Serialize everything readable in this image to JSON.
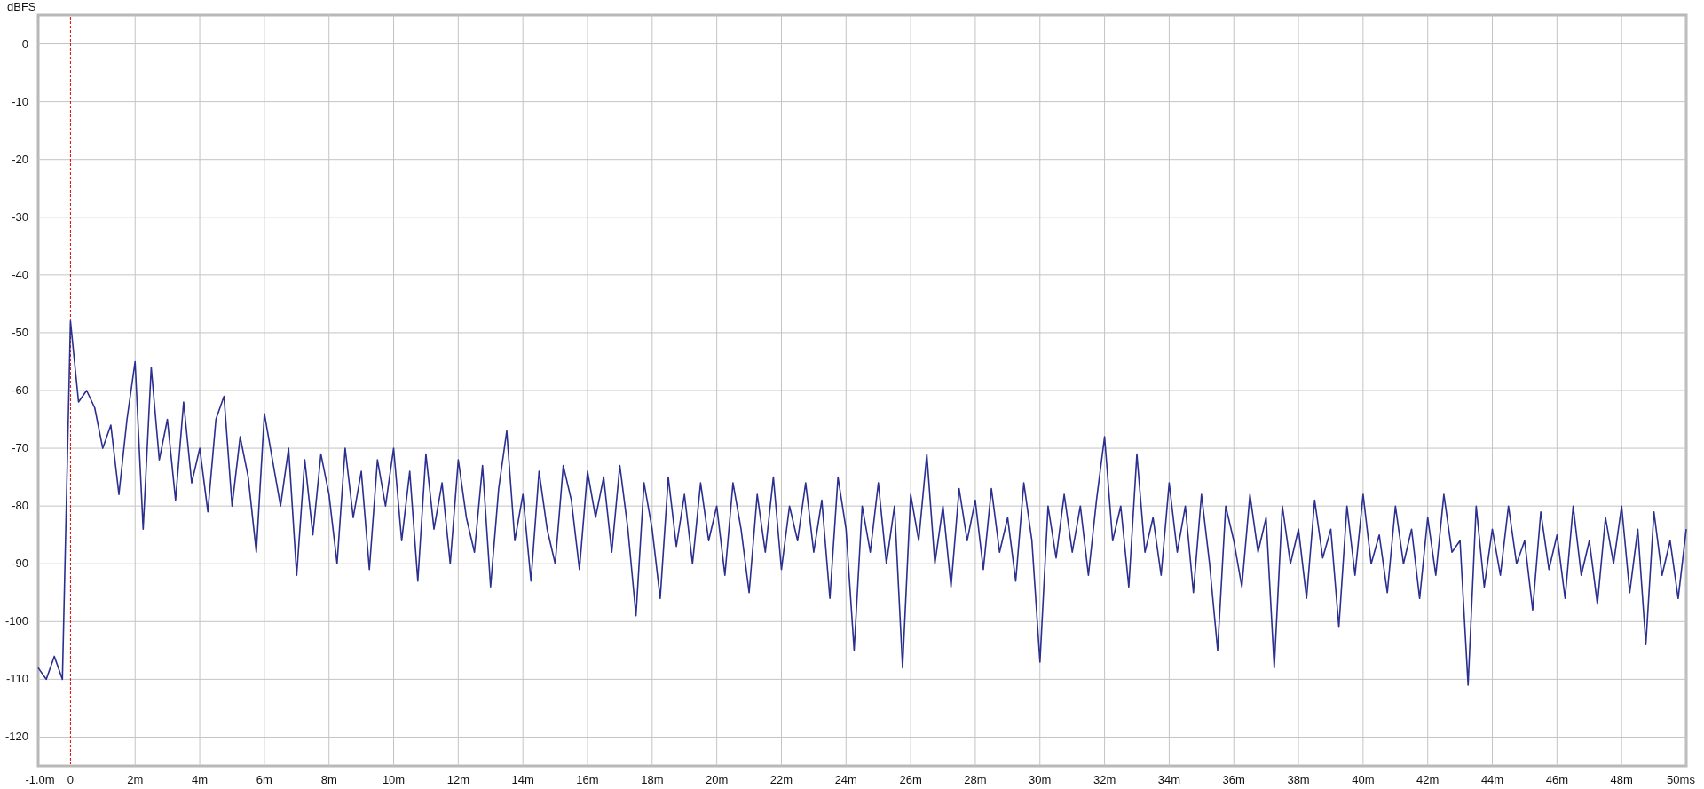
{
  "chart_data": {
    "type": "line",
    "ylabel": "dBFS",
    "xlim": [
      -1,
      50
    ],
    "ylim": [
      -125,
      5
    ],
    "grid": true,
    "ref_lines": [
      {
        "axis": "x",
        "value": 0,
        "color": "#e00000"
      }
    ],
    "yticks": [
      0,
      -10,
      -20,
      -30,
      -40,
      -50,
      -60,
      -70,
      -80,
      -90,
      -100,
      -110,
      -120
    ],
    "xticks": [
      {
        "value": -1,
        "label": "-1.0m"
      },
      {
        "value": 0,
        "label": "0"
      },
      {
        "value": 2,
        "label": "2m"
      },
      {
        "value": 4,
        "label": "4m"
      },
      {
        "value": 6,
        "label": "6m"
      },
      {
        "value": 8,
        "label": "8m"
      },
      {
        "value": 10,
        "label": "10m"
      },
      {
        "value": 12,
        "label": "12m"
      },
      {
        "value": 14,
        "label": "14m"
      },
      {
        "value": 16,
        "label": "16m"
      },
      {
        "value": 18,
        "label": "18m"
      },
      {
        "value": 20,
        "label": "20m"
      },
      {
        "value": 22,
        "label": "22m"
      },
      {
        "value": 24,
        "label": "24m"
      },
      {
        "value": 26,
        "label": "26m"
      },
      {
        "value": 28,
        "label": "28m"
      },
      {
        "value": 30,
        "label": "30m"
      },
      {
        "value": 32,
        "label": "32m"
      },
      {
        "value": 34,
        "label": "34m"
      },
      {
        "value": 36,
        "label": "36m"
      },
      {
        "value": 38,
        "label": "38m"
      },
      {
        "value": 40,
        "label": "40m"
      },
      {
        "value": 42,
        "label": "42m"
      },
      {
        "value": 44,
        "label": "44m"
      },
      {
        "value": 46,
        "label": "46m"
      },
      {
        "value": 48,
        "label": "48m"
      },
      {
        "value": 50,
        "label": "50ms"
      }
    ],
    "x": [
      -1,
      -0.75,
      -0.5,
      -0.25,
      0,
      0.25,
      0.5,
      0.75,
      1,
      1.25,
      1.5,
      1.75,
      2,
      2.25,
      2.5,
      2.75,
      3,
      3.25,
      3.5,
      3.75,
      4,
      4.25,
      4.5,
      4.75,
      5,
      5.25,
      5.5,
      5.75,
      6,
      6.25,
      6.5,
      6.75,
      7,
      7.25,
      7.5,
      7.75,
      8,
      8.25,
      8.5,
      8.75,
      9,
      9.25,
      9.5,
      9.75,
      10,
      10.25,
      10.5,
      10.75,
      11,
      11.25,
      11.5,
      11.75,
      12,
      12.25,
      12.5,
      12.75,
      13,
      13.25,
      13.5,
      13.75,
      14,
      14.25,
      14.5,
      14.75,
      15,
      15.25,
      15.5,
      15.75,
      16,
      16.25,
      16.5,
      16.75,
      17,
      17.25,
      17.5,
      17.75,
      18,
      18.25,
      18.5,
      18.75,
      19,
      19.25,
      19.5,
      19.75,
      20,
      20.25,
      20.5,
      20.75,
      21,
      21.25,
      21.5,
      21.75,
      22,
      22.25,
      22.5,
      22.75,
      23,
      23.25,
      23.5,
      23.75,
      24,
      24.25,
      24.5,
      24.75,
      25,
      25.25,
      25.5,
      25.75,
      26,
      26.25,
      26.5,
      26.75,
      27,
      27.25,
      27.5,
      27.75,
      28,
      28.25,
      28.5,
      28.75,
      29,
      29.25,
      29.5,
      29.75,
      30,
      30.25,
      30.5,
      30.75,
      31,
      31.25,
      31.5,
      31.75,
      32,
      32.25,
      32.5,
      32.75,
      33,
      33.25,
      33.5,
      33.75,
      34,
      34.25,
      34.5,
      34.75,
      35,
      35.25,
      35.5,
      35.75,
      36,
      36.25,
      36.5,
      36.75,
      37,
      37.25,
      37.5,
      37.75,
      38,
      38.25,
      38.5,
      38.75,
      39,
      39.25,
      39.5,
      39.75,
      40,
      40.25,
      40.5,
      40.75,
      41,
      41.25,
      41.5,
      41.75,
      42,
      42.25,
      42.5,
      42.75,
      43,
      43.25,
      43.5,
      43.75,
      44,
      44.25,
      44.5,
      44.75,
      45,
      45.25,
      45.5,
      45.75,
      46,
      46.25,
      46.5,
      46.75,
      47,
      47.25,
      47.5,
      47.75,
      48,
      48.25,
      48.5,
      48.75,
      49,
      49.25,
      49.5,
      49.75,
      50
    ],
    "series": [
      {
        "color": "#2b2f8f",
        "values": [
          -108,
          -110,
          -106,
          -110,
          -48,
          -62,
          -60,
          -63,
          -70,
          -66,
          -78,
          -65,
          -55,
          -84,
          -56,
          -72,
          -65,
          -79,
          -62,
          -76,
          -70,
          -81,
          -65,
          -61,
          -80,
          -68,
          -75,
          -88,
          -64,
          -72,
          -80,
          -70,
          -92,
          -72,
          -85,
          -71,
          -78,
          -90,
          -70,
          -82,
          -74,
          -91,
          -72,
          -80,
          -70,
          -86,
          -74,
          -93,
          -71,
          -84,
          -76,
          -90,
          -72,
          -82,
          -88,
          -73,
          -94,
          -77,
          -67,
          -86,
          -78,
          -93,
          -74,
          -84,
          -90,
          -73,
          -79,
          -91,
          -74,
          -82,
          -75,
          -88,
          -73,
          -84,
          -99,
          -76,
          -84,
          -96,
          -75,
          -87,
          -78,
          -90,
          -76,
          -86,
          -80,
          -92,
          -76,
          -84,
          -95,
          -78,
          -88,
          -75,
          -91,
          -80,
          -86,
          -76,
          -88,
          -79,
          -96,
          -75,
          -84,
          -105,
          -80,
          -88,
          -76,
          -90,
          -80,
          -108,
          -78,
          -86,
          -71,
          -90,
          -80,
          -94,
          -77,
          -86,
          -79,
          -91,
          -77,
          -88,
          -82,
          -93,
          -76,
          -86,
          -107,
          -80,
          -89,
          -78,
          -88,
          -80,
          -92,
          -79,
          -68,
          -86,
          -80,
          -94,
          -71,
          -88,
          -82,
          -92,
          -76,
          -88,
          -80,
          -95,
          -78,
          -90,
          -105,
          -80,
          -86,
          -94,
          -78,
          -88,
          -82,
          -108,
          -80,
          -90,
          -84,
          -96,
          -79,
          -89,
          -84,
          -101,
          -80,
          -92,
          -78,
          -90,
          -85,
          -95,
          -80,
          -90,
          -84,
          -96,
          -82,
          -92,
          -78,
          -88,
          -86,
          -111,
          -80,
          -94,
          -84,
          -92,
          -80,
          -90,
          -86,
          -98,
          -81,
          -91,
          -85,
          -96,
          -80,
          -92,
          -86,
          -97,
          -82,
          -90,
          -80,
          -95,
          -84,
          -104,
          -81,
          -92,
          -86,
          -96,
          -84
        ]
      }
    ]
  }
}
